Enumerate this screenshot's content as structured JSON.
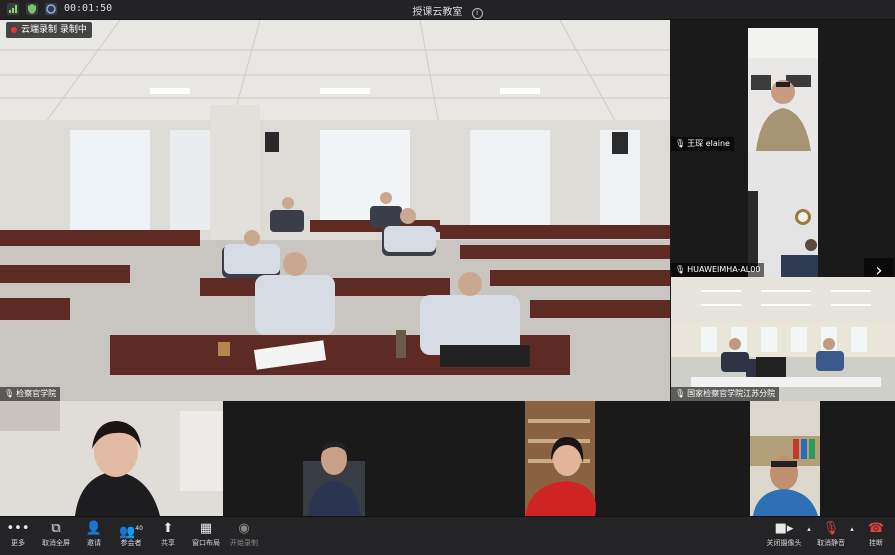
{
  "window": {
    "title": "授课云教室",
    "timer": "00:01:50"
  },
  "recording": {
    "label": "云端录制 录制中"
  },
  "main_tile": {
    "name": "检察官学院"
  },
  "side_tiles": [
    {
      "name": "王琛 elaine"
    },
    {
      "name": "HUAWEIMHA-AL00"
    },
    {
      "name": "国家检察官学院江苏分院"
    }
  ],
  "toolbar": {
    "more": "更多",
    "cancel_fullscreen": "取消全屏",
    "invite": "邀请",
    "participants": "参会者",
    "participants_count": "40",
    "share": "共享",
    "window_layout": "窗口布局",
    "start_record": "开始录制",
    "camera_off": "关闭摄像头",
    "unmute": "取消静音",
    "hangup": "挂断"
  },
  "colors": {
    "hangup": "#e0433f",
    "mute_icon": "#e0433f",
    "rec_dot": "#e33"
  }
}
